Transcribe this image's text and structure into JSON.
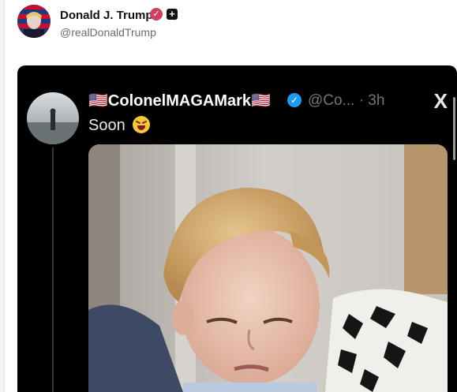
{
  "post": {
    "author_name": "Donald J. Trump",
    "author_handle": "@realDonaldTrump",
    "verified_icon": "check-badge-icon",
    "plus_icon": "plus-square-icon"
  },
  "embed": {
    "author_name": "🇺🇸ColonelMAGAMark🇺🇸",
    "handle_time": "@Co... · 3h",
    "x_logo": "X",
    "text": "Soon",
    "emoji": "grinning-squinting-face-icon"
  },
  "colors": {
    "embed_background": "#000000",
    "verified_pink": "#d1405e",
    "verified_blue": "#1d9bf0"
  }
}
